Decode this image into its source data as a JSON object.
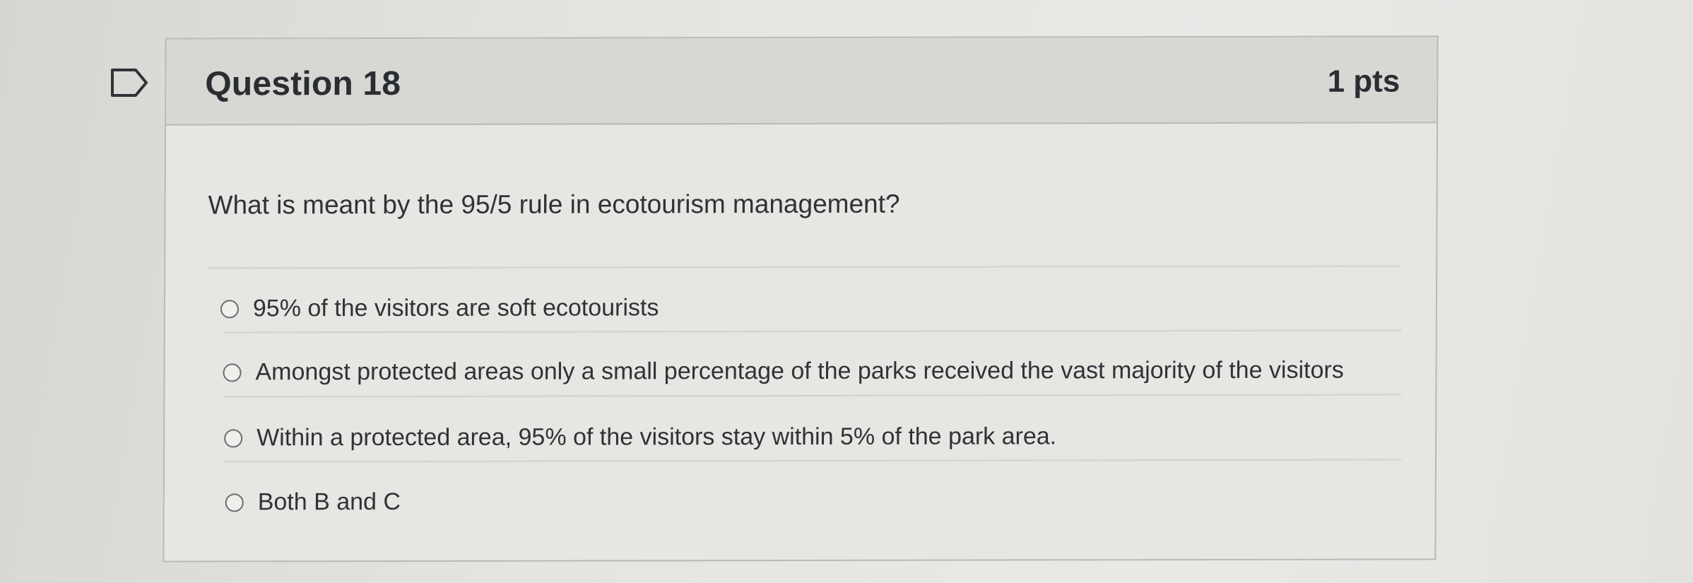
{
  "question": {
    "title": "Question 18",
    "points": "1 pts",
    "text": "What is meant by the 95/5 rule in ecotourism management?"
  },
  "answers": [
    {
      "label": "95% of the visitors are soft ecotourists"
    },
    {
      "label": "Amongst protected areas only a small percentage of the parks received the vast majority of the visitors"
    },
    {
      "label": "Within a protected area, 95% of the visitors stay within 5% of the park area."
    },
    {
      "label": "Both B and C"
    }
  ],
  "icons": {
    "flag": "flag-question-icon",
    "radio": "radio-button-icon"
  },
  "colors": {
    "header_background": "#d7d7d4",
    "card_background": "#e6e6e3",
    "text": "#2f3236"
  }
}
